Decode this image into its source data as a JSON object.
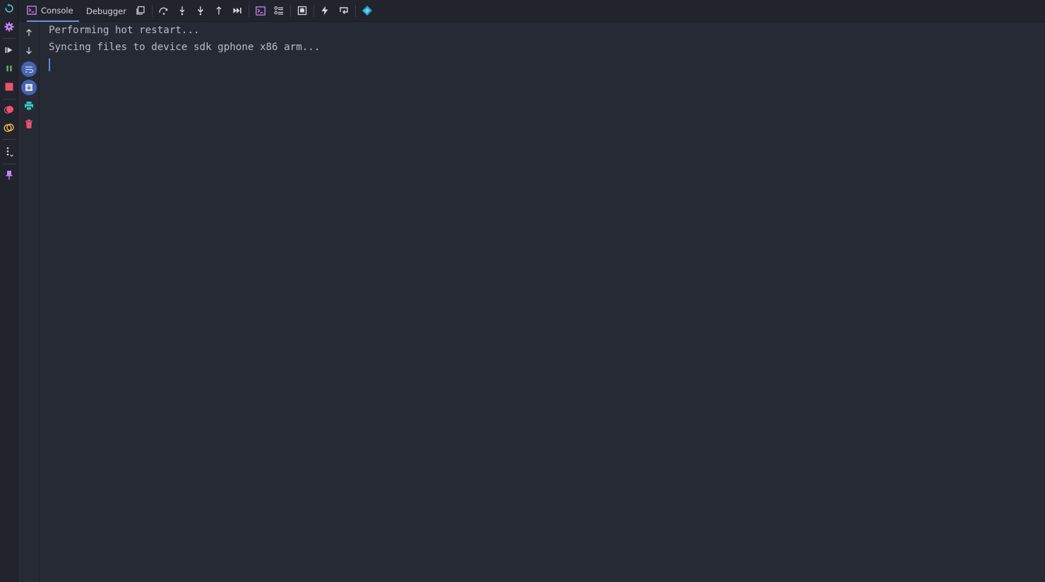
{
  "header": {
    "tabs": [
      {
        "label": "Console",
        "icon": "console-icon",
        "active": true
      },
      {
        "label": "Debugger",
        "active": false
      }
    ],
    "toolbar": [
      "layout-icon",
      "step-over-icon",
      "step-into-icon",
      "force-step-into-icon",
      "step-out-icon",
      "run-to-cursor-icon",
      "evaluate-expression-icon",
      "frames-list-icon",
      "snapshot-icon",
      "hot-reload-icon",
      "hot-restart-icon",
      "flutter-inspector-icon"
    ]
  },
  "left_strip": {
    "icons": [
      "rerun-icon",
      "settings-icon",
      "resume-icon",
      "pause-icon",
      "stop-icon",
      "view-breakpoints-icon",
      "mute-breakpoints-icon",
      "more-options-icon",
      "pin-tab-icon"
    ]
  },
  "console_gutter": {
    "icons": [
      "up-arrow-icon",
      "down-arrow-icon",
      "soft-wrap-icon",
      "scroll-to-end-icon",
      "print-icon",
      "clear-all-icon"
    ]
  },
  "console": {
    "lines": [
      "Performing hot restart...",
      "Syncing files to device sdk gphone x86 arm..."
    ]
  },
  "colors": {
    "background": "#262a34",
    "panel": "#21242c",
    "accent": "#6f8fdd",
    "stop_red": "#f0506e",
    "resume_green": "#6cc06c",
    "purple": "#c586f4",
    "teal": "#35c5c9"
  }
}
